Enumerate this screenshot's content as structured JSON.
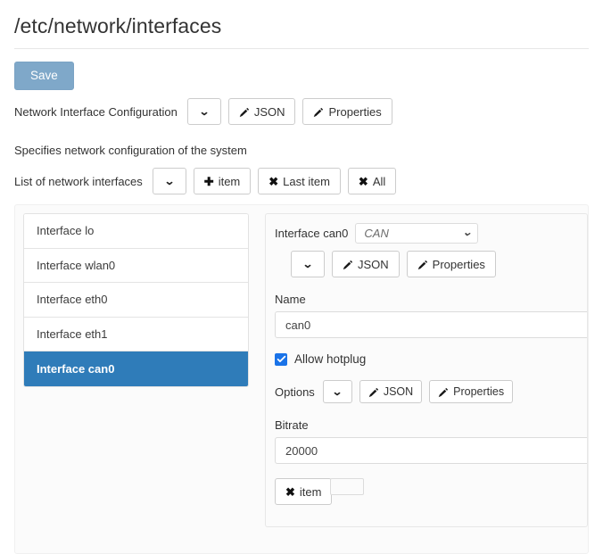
{
  "document": {
    "title": "/etc/network/interfaces"
  },
  "toolbar": {
    "save_label": "Save",
    "root_label": "Network Interface Configuration",
    "collapse_icon": "chevron-down-icon",
    "json_label": "JSON",
    "properties_label": "Properties",
    "edit_icon": "pencil-icon"
  },
  "description": "Specifies network configuration of the system",
  "list_toolbar": {
    "label": "List of network interfaces",
    "collapse_icon": "chevron-down-icon",
    "add_item_label": "item",
    "add_item_icon": "plus-icon",
    "delete_last_label": "Last item",
    "delete_last_icon": "times-icon",
    "delete_all_label": "All",
    "delete_all_icon": "times-icon"
  },
  "interface_list": {
    "items": [
      {
        "label": "Interface lo",
        "selected": false
      },
      {
        "label": "Interface wlan0",
        "selected": false
      },
      {
        "label": "Interface eth0",
        "selected": false
      },
      {
        "label": "Interface eth1",
        "selected": false
      },
      {
        "label": "Interface can0",
        "selected": true
      }
    ]
  },
  "detail": {
    "header_label": "Interface can0",
    "type_value": "CAN",
    "type_caret_icon": "chevron-down-icon",
    "collapse_icon": "chevron-down-icon",
    "json_label": "JSON",
    "properties_label": "Properties",
    "name_label": "Name",
    "name_value": "can0",
    "hotplug_label": "Allow hotplug",
    "hotplug_checked": true,
    "hotplug_icon": "check-icon",
    "options_label": "Options",
    "options_json_label": "JSON",
    "options_properties_label": "Properties",
    "bitrate_label": "Bitrate",
    "bitrate_value": "20000",
    "remove_item_label": "item",
    "remove_item_icon": "times-icon"
  },
  "colors": {
    "accent": "#2f7cb9",
    "save_button": "#7fa8c9",
    "checkbox": "#1a73e8",
    "border": "#cccccc"
  }
}
